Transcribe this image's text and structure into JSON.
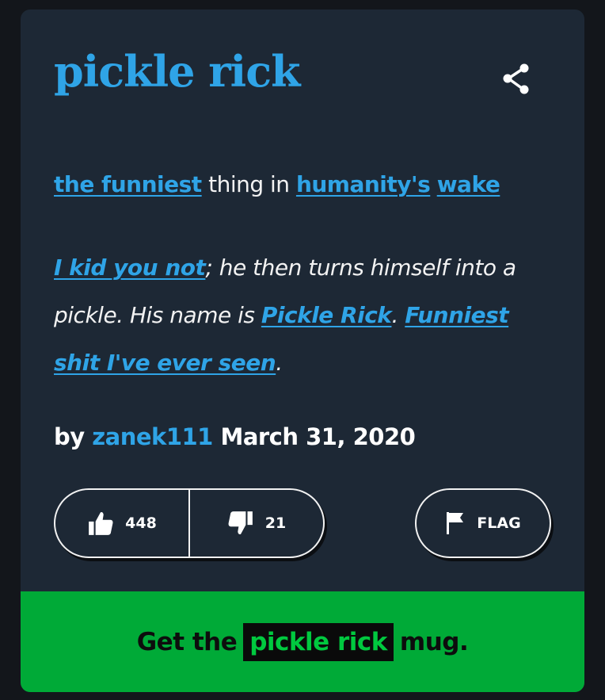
{
  "entry": {
    "word": "pickle rick",
    "meaning": {
      "link1": "the funniest",
      "text1": " thing in ",
      "link2": "humanity's",
      "text2": " ",
      "link3": "wake"
    },
    "example": {
      "link1": "I kid you not",
      "text1": "; he then turns himself into a pickle. His name is ",
      "link2": "Pickle Rick",
      "text2": ". ",
      "link3": "Funniest shit I've ever seen",
      "text3": "."
    },
    "byline": {
      "prefix": "by ",
      "author": "zanek111",
      "date": " March 31, 2020"
    }
  },
  "actions": {
    "upvotes": "448",
    "downvotes": "21",
    "flag_label": "FLAG"
  },
  "promo": {
    "prefix": "Get the ",
    "highlight": "pickle rick",
    "suffix": " mug."
  },
  "icons": {
    "share": "share-icon",
    "thumbs_up": "thumbs-up-icon",
    "thumbs_down": "thumbs-down-icon",
    "flag": "flag-icon"
  },
  "colors": {
    "background": "#13161b",
    "card": "#1d2835",
    "accent": "#2fa4e7",
    "promo": "#00aa37"
  }
}
